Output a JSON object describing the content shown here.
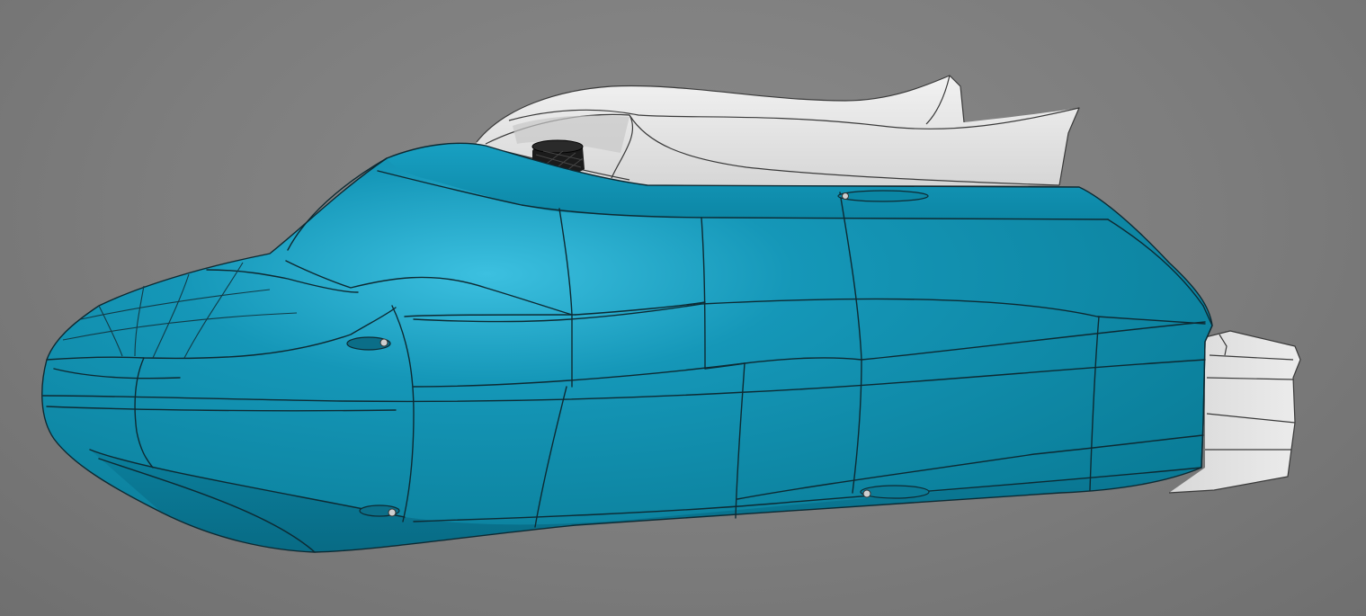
{
  "scene": {
    "subject": "boat-hull-cad-model",
    "background_color": "#7f7f7f",
    "hull_color": "#0a8aa8",
    "hull_highlight_color": "#36b8dc",
    "hull_shadow_color": "#066a84",
    "canopy_color": "#e6e6e6",
    "canopy_shadow_color": "#c9c9c9",
    "cap_color": "#1a1a1a",
    "edge_color": "#0d2a33"
  }
}
